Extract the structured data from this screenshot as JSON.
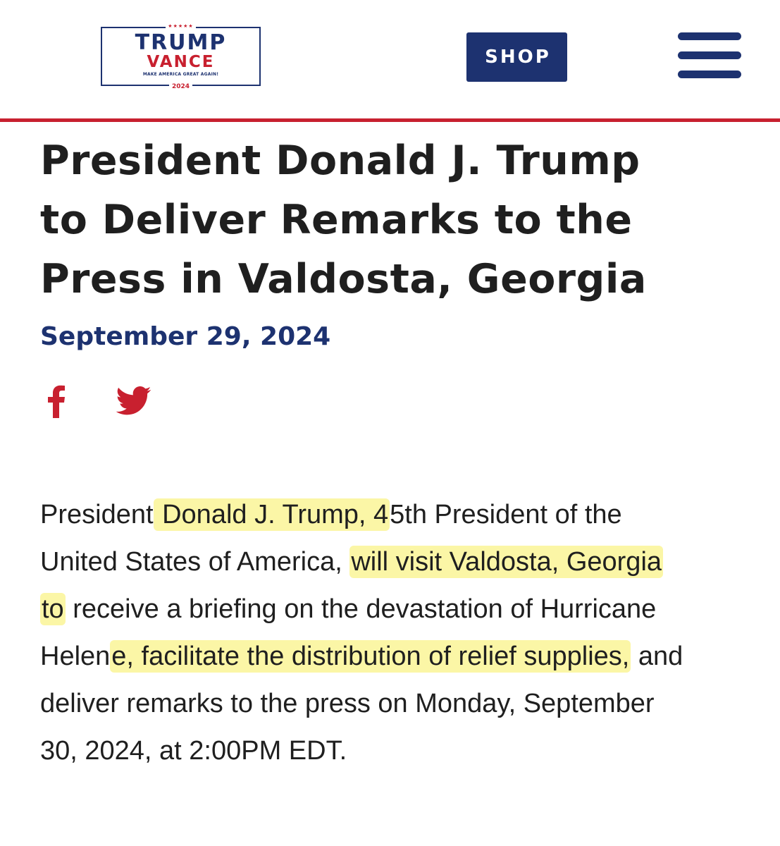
{
  "header": {
    "logo": {
      "stars": "★★★★★",
      "line1": "TRUMP",
      "line2": "VANCE",
      "slogan": "MAKE AMERICA GREAT AGAIN!",
      "year": "2024"
    },
    "shop_label": "SHOP",
    "menu_icon": "hamburger-menu-icon"
  },
  "colors": {
    "navy": "#1d3270",
    "red": "#c8202f",
    "highlight": "#fbf6a6",
    "text": "#1f1f1f"
  },
  "article": {
    "title_lines": [
      "President Donald J. Trump",
      "to Deliver Remarks to the",
      "Press in Valdosta, Georgia"
    ],
    "date": "September 29, 2024",
    "share": {
      "facebook_icon": "facebook-icon",
      "twitter_icon": "twitter-icon"
    },
    "body": {
      "line1": {
        "a": "President",
        "hl": " Donald J. Trump, 4",
        "b": "5th President of the"
      },
      "line2": {
        "a": "United States of America, ",
        "hl": "will visit Valdosta, Georgia"
      },
      "line3": {
        "hl": "to",
        "a": " receive a briefing on the devastation of Hurricane"
      },
      "line4": {
        "a": "Helen",
        "hl": "e, facilitate the distribution of relief supplies,",
        "b": " and"
      },
      "line5": "deliver remarks to the press on Monday, September",
      "line6": "30, 2024, at 2:00PM EDT."
    }
  }
}
